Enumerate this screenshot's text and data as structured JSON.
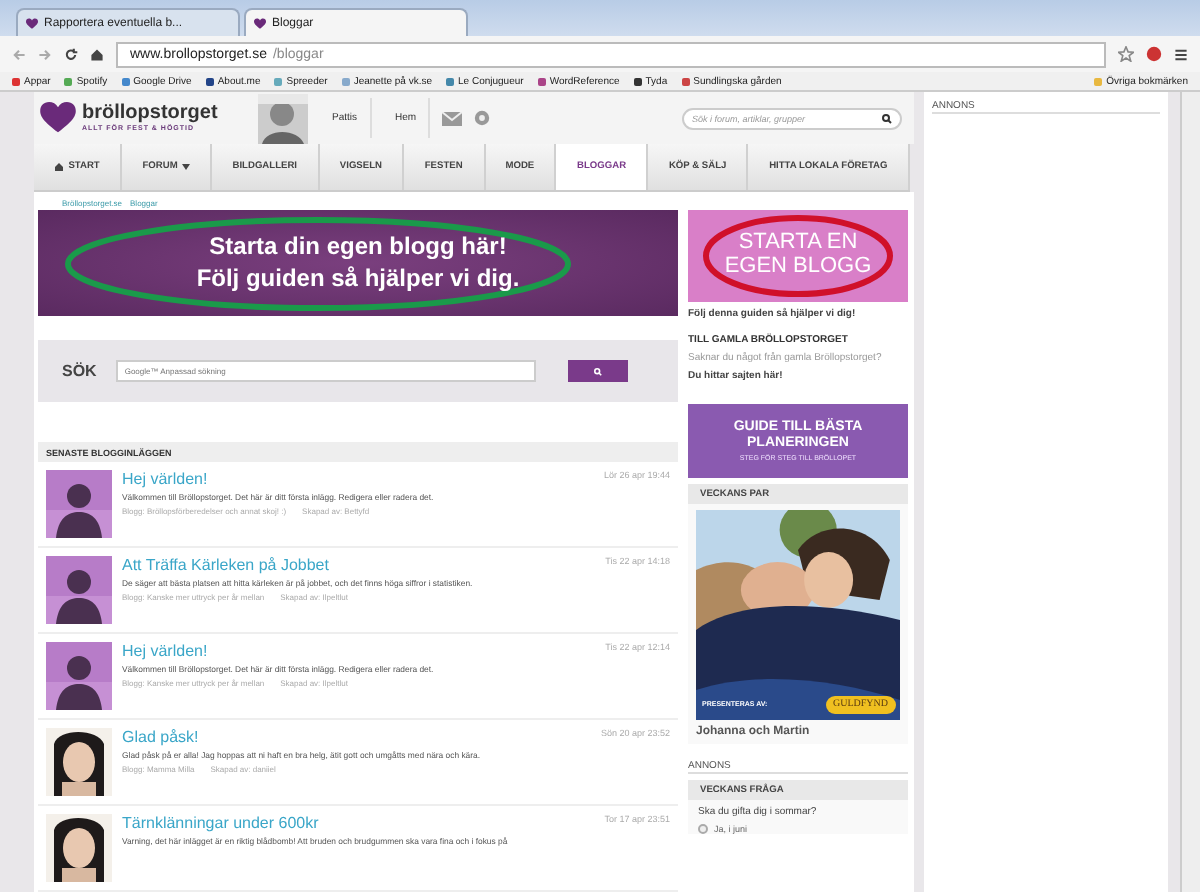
{
  "browser": {
    "tabs": [
      {
        "title": "Rapportera eventuella b...",
        "selected": false
      },
      {
        "title": "Bloggar",
        "selected": true
      }
    ],
    "url_host": "www.brollopstorget.se",
    "url_path": "/bloggar",
    "bookmarks": [
      "Appar",
      "Spotify",
      "Google Drive",
      "About.me",
      "Spreeder",
      "Jeanette på vk.se",
      "Le Conjugueur",
      "WordReference",
      "Tyda",
      "Sundlingska gården"
    ],
    "other_bookmarks": "Övriga bokmärken"
  },
  "header": {
    "logo": "bröllopstorget",
    "tagline": "ALLT FÖR FEST & HÖGTID",
    "user": "Pattis",
    "home": "Hem",
    "search_placeholder": "Sök i forum, artiklar, grupper"
  },
  "nav": [
    {
      "label": "START",
      "selected": false,
      "kind": "home"
    },
    {
      "label": "FORUM",
      "selected": false,
      "kind": "menu"
    },
    {
      "label": "BILDGALLERI",
      "selected": false,
      "kind": "plain"
    },
    {
      "label": "VIGSELN",
      "selected": false,
      "kind": "plain"
    },
    {
      "label": "FESTEN",
      "selected": false,
      "kind": "plain"
    },
    {
      "label": "MODE",
      "selected": false,
      "kind": "plain"
    },
    {
      "label": "BLOGGAR",
      "selected": true,
      "kind": "plain"
    },
    {
      "label": "KÖP & SÄLJ",
      "selected": false,
      "kind": "plain"
    },
    {
      "label": "HITTA LOKALA FÖRETAG",
      "selected": false,
      "kind": "plain"
    }
  ],
  "breadcrumb": [
    "Bröllopstorget.se",
    "Bloggar"
  ],
  "banner": [
    "Starta din egen blogg här!",
    "Följ guiden så hjälper vi dig."
  ],
  "search": {
    "label": "SÖK",
    "placeholder": "Google™ Anpassad sökning"
  },
  "posts_heading": "SENASTE BLOGGINLÄGGEN",
  "posts": [
    {
      "kind": "silhouette",
      "title": "Hej världen!",
      "excerpt": "Välkommen till Bröllopstorget. Det här är ditt första inlägg. Redigera eller radera det.",
      "blog": "Blogg: Bröllopsförberedelser och annat skoj! :)",
      "author": "Skapad av: Bettyfd",
      "date": "Lör 26 apr 19:44"
    },
    {
      "kind": "silhouette",
      "title": "Att Träffa Kärleken på Jobbet",
      "excerpt": "De säger att bästa platsen att hitta kärleken är på jobbet, och det finns höga siffror i statistiken.",
      "blog": "Blogg: Kanske mer uttryck per år mellan",
      "author": "Skapad av: Ilpeltlut",
      "date": "Tis 22 apr 14:18"
    },
    {
      "kind": "silhouette",
      "title": "Hej världen!",
      "excerpt": "Välkommen till Bröllopstorget. Det här är ditt första inlägg. Redigera eller radera det.",
      "blog": "Blogg: Kanske mer uttryck per år mellan",
      "author": "Skapad av: Ilpeltlut",
      "date": "Tis 22 apr 12:14"
    },
    {
      "title": "Glad påsk!",
      "excerpt": "Glad påsk på er alla! Jag hoppas att ni haft en bra helg, ätit gott och umgåtts med nära och kära.",
      "blog": "Blogg: Mamma Milla",
      "author": "Skapad av: daniiel",
      "date": "Sön 20 apr 23:52"
    },
    {
      "title": "Tärnklänningar under 600kr",
      "excerpt": "Varning, det här inlägget är en riktig blådbomb! Att bruden och brudgummen ska vara fina och i fokus på",
      "date": "Tor 17 apr 23:51"
    }
  ],
  "sidebar": {
    "ad": "STARTA EN EGEN BLOGG",
    "ad_link": "Följ denna guiden så hjälper vi dig!",
    "old_heading": "TILL GAMLA BRÖLLOPSTORGET",
    "old_text": "Saknar du något från gamla Bröllopstorget?",
    "old_link": "Du hittar sajten här!",
    "guide_title": "GUIDE TILL BÄSTA PLANERINGEN",
    "guide_sub": "STEG FÖR STEG TILL BRÖLLOPET",
    "couple_heading": "VECKANS PAR",
    "presented": "PRESENTERAS AV:",
    "sponsor": "GULDFYND",
    "couple": "Johanna och Martin",
    "annons": "ANNONS",
    "question_heading": "VECKANS FRÅGA",
    "question": "Ska du gifta dig i sommar?",
    "options": [
      {
        "label": "Ja, i juni",
        "selected": false
      }
    ]
  },
  "side_annons": "ANNONS"
}
